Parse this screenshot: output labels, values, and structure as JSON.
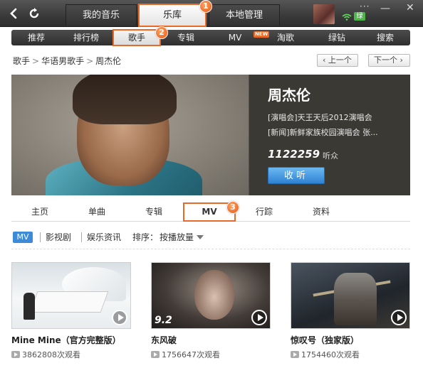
{
  "topbar": {
    "tabs": [
      {
        "label": "我的音乐"
      },
      {
        "label": "乐库"
      },
      {
        "label": "本地管理"
      }
    ],
    "more_label": "···",
    "minimize_label": "—",
    "close_label": "✕",
    "vip_label": "绿"
  },
  "subnav": {
    "items": [
      {
        "label": "推荐"
      },
      {
        "label": "排行榜"
      },
      {
        "label": "歌手"
      },
      {
        "label": "专辑"
      },
      {
        "label": "MV"
      },
      {
        "label": "淘歌"
      },
      {
        "label": "绿钻"
      },
      {
        "label": "搜索"
      }
    ],
    "new_badge": "NEW"
  },
  "badges": [
    "1",
    "2",
    "3"
  ],
  "breadcrumb": {
    "items": [
      "歌手",
      "华语男歌手",
      "周杰伦"
    ],
    "separator": ">"
  },
  "pager": {
    "prev": "上一个",
    "next": "下一个"
  },
  "artist": {
    "name": "周杰伦",
    "news": [
      "[演唱会]天王天后2012演唱会",
      "[新闻]新鲜家族校园演唱会 张..."
    ],
    "fans": "1122259",
    "fans_label": "听众",
    "listen_label": "收听"
  },
  "profile_tabs": [
    {
      "label": "主页"
    },
    {
      "label": "单曲"
    },
    {
      "label": "专辑"
    },
    {
      "label": "MV"
    },
    {
      "label": "行踪"
    },
    {
      "label": "资料"
    }
  ],
  "filter": {
    "chip": "MV",
    "items": [
      "影视剧",
      "娱乐资讯"
    ],
    "sort_label": "排序：",
    "sort_value": "按播放量"
  },
  "mvs": [
    {
      "title": "Mine Mine（官方完整版）",
      "views": "3862808次观看",
      "rating": ""
    },
    {
      "title": "东风破",
      "views": "1756647次观看",
      "rating": "9.2"
    },
    {
      "title": "惊叹号（独家版）",
      "views": "1754460次观看",
      "rating": ""
    }
  ],
  "colors": {
    "highlight": "#e86a2a",
    "accent_blue": "#3d8bd8",
    "topbar": "#3a3a3a"
  }
}
